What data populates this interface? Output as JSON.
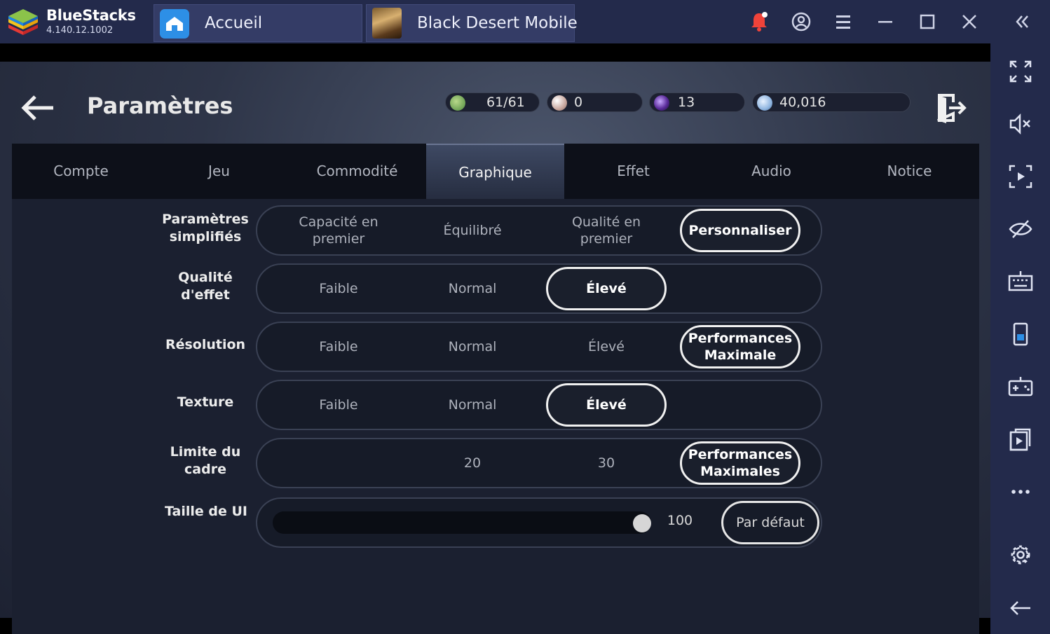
{
  "bluestacks": {
    "name": "BlueStacks",
    "version": "4.140.12.1002",
    "tabs": [
      {
        "label": "Accueil"
      },
      {
        "label": "Black Desert Mobile"
      }
    ]
  },
  "sidebar": {
    "buttons": [
      "fullscreen-icon",
      "volume-mute-icon",
      "screen-record-icon",
      "eye-hide-icon",
      "keyboard-icon",
      "portrait-icon",
      "gamepad-icon",
      "media-icon",
      "more-icon",
      "settings-icon",
      "back-icon"
    ]
  },
  "game": {
    "title": "Paramètres",
    "resources": [
      {
        "name": "energy",
        "value": "61/61",
        "color": "#5f9b55"
      },
      {
        "name": "pearl",
        "value": "0",
        "color": "#cdb7b0"
      },
      {
        "name": "crystal",
        "value": "13",
        "color": "#5a2b9a"
      },
      {
        "name": "silver",
        "value": "40,016",
        "color": "#8fb5e0"
      }
    ],
    "tabs": [
      "Compte",
      "Jeu",
      "Commodité",
      "Graphique",
      "Effet",
      "Audio",
      "Notice"
    ],
    "active_tab": "Graphique",
    "rows": [
      {
        "label": "Paramètres simplifiés",
        "options": [
          "Capacité en premier",
          "Équilibré",
          "Qualité en premier",
          "Personnaliser"
        ],
        "selected": "Personnaliser"
      },
      {
        "label": "Qualité d'effet",
        "options": [
          "Faible",
          "Normal",
          "Élevé"
        ],
        "selected": "Élevé"
      },
      {
        "label": "Résolution",
        "options": [
          "Faible",
          "Normal",
          "Élevé",
          "Performances Maximale"
        ],
        "selected": "Performances Maximale"
      },
      {
        "label": "Texture",
        "options": [
          "Faible",
          "Normal",
          "Élevé"
        ],
        "selected": "Élevé"
      },
      {
        "label": "Limite du cadre",
        "options": [
          "20",
          "30",
          "Performances Maximales"
        ],
        "selected": "Performances Maximales"
      }
    ],
    "ui_size": {
      "label": "Taille de UI",
      "value": "100",
      "level": 1.0,
      "default_label": "Par défaut"
    }
  }
}
